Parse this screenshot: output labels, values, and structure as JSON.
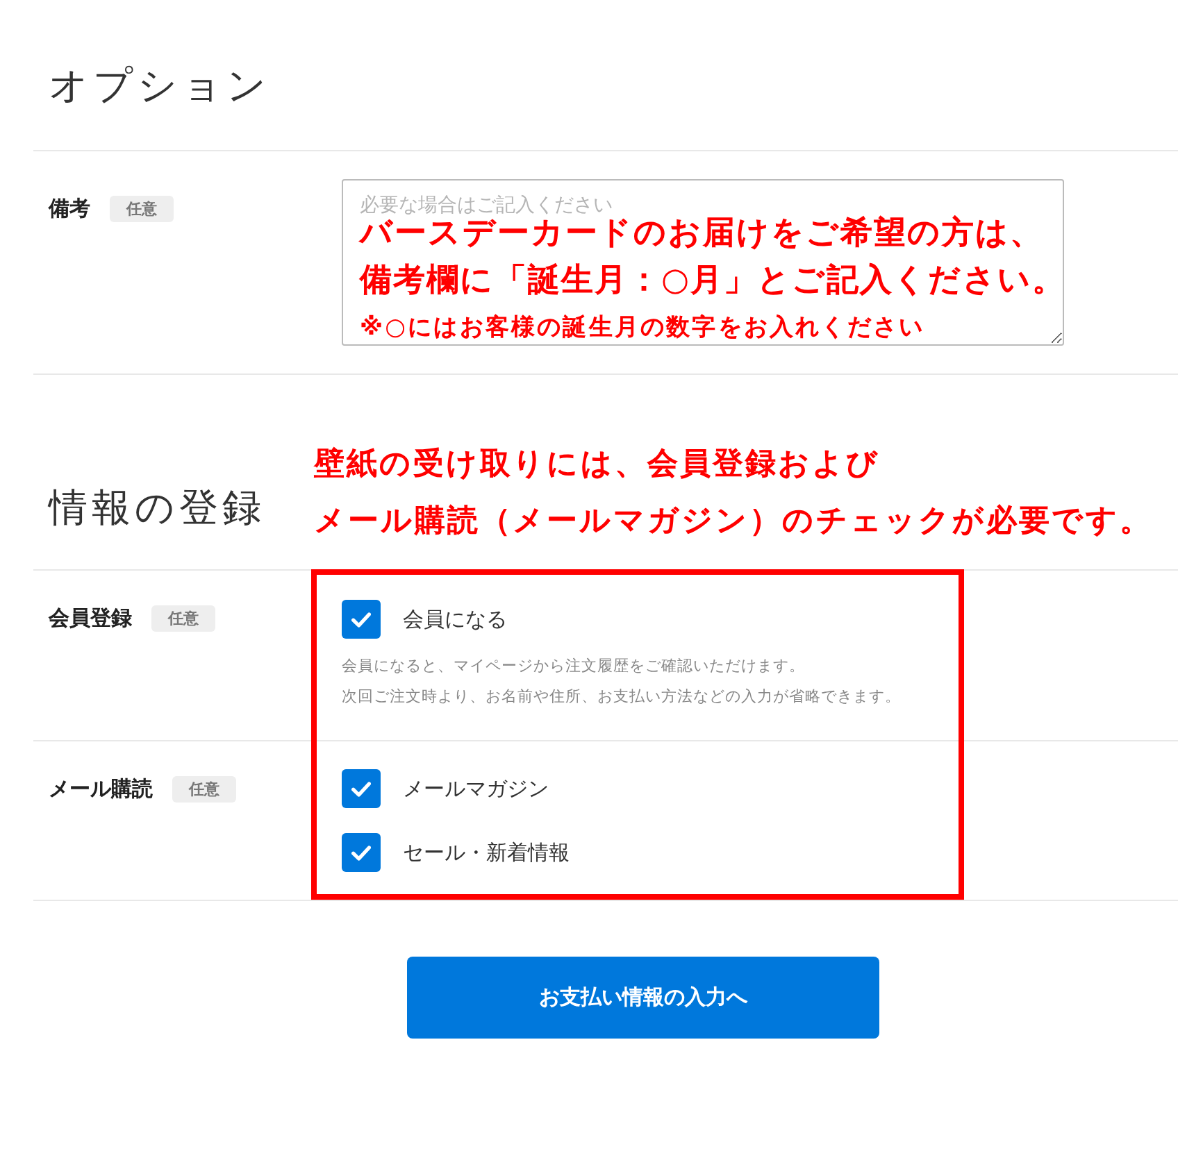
{
  "options": {
    "title": "オプション",
    "rows": [
      {
        "label": "備考",
        "badge": "任意",
        "field": {
          "placeholder": "必要な場合はご記入ください"
        }
      }
    ],
    "annotation": {
      "lines": [
        "バースデーカードのお届けをご希望の方は、",
        "備考欄に「誕生月：○月」とご記入ください。"
      ],
      "note": "※○にはお客様の誕生月の数字をお入れください"
    }
  },
  "registration": {
    "title": "情報の登録",
    "annotation": {
      "lines": [
        "壁紙の受け取りには、会員登録および",
        "メール購読（メールマガジン）のチェックが必要です。"
      ]
    },
    "rows": [
      {
        "label": "会員登録",
        "badge": "任意",
        "options": [
          {
            "label": "会員になる",
            "checked": true
          }
        ],
        "description": [
          "会員になると、マイページから注文履歴をご確認いただけます。",
          "次回ご注文時より、お名前や住所、お支払い方法などの入力が省略できます。"
        ]
      },
      {
        "label": "メール購読",
        "badge": "任意",
        "options": [
          {
            "label": "メールマガジン",
            "checked": true
          },
          {
            "label": "セール・新着情報",
            "checked": true
          }
        ]
      }
    ]
  },
  "submit_button": "お支払い情報の入力へ"
}
